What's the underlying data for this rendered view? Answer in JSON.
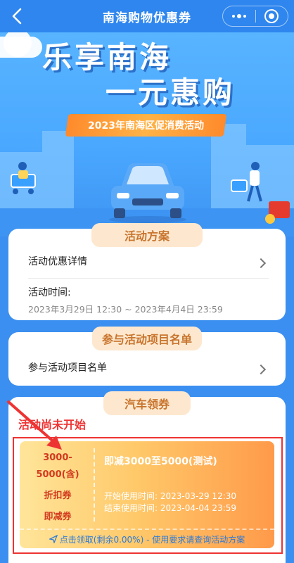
{
  "topbar": {
    "title": "南海购物优惠券"
  },
  "hero": {
    "headline_1": "乐享南海",
    "headline_2": "一元惠购",
    "ribbon": "2023年南海区促消费活动"
  },
  "plan_card": {
    "tab": "活动方案",
    "details_label": "活动优惠详情",
    "time_label": "活动时间:",
    "time_value": "2023年3月29日 12:30 ~ 2023年4月4日 23:59"
  },
  "projects_card": {
    "tab": "参与活动项目名单",
    "item_label": "参与活动项目名单"
  },
  "coupon_card": {
    "tab": "汽车领券",
    "status": "活动尚未开始",
    "range": "3000-5000(含)",
    "type_1": "折扣券",
    "type_2": "即减券",
    "title": "即减3000至5000(测试)",
    "start_label": "开始使用时间:",
    "start_value": "2023-03-29 12:30",
    "end_label": "结束使用时间:",
    "end_value": "2023-04-04 23:59",
    "action": "点击领取(剩余0.00%) - 使用要求请查询活动方案"
  },
  "colors": {
    "primary_blue": "#2e86ee",
    "tab_bg": "#fde8cf",
    "tab_text": "#c8742d",
    "alert_red": "#e33",
    "coupon_text_red": "#d23a1f"
  },
  "icons": [
    "back-arrow-icon",
    "more-dots-icon",
    "target-icon",
    "chevron-right-icon",
    "send-icon",
    "red-arrow-annotation"
  ]
}
